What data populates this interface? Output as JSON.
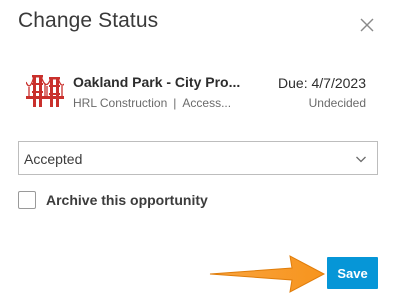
{
  "dialog": {
    "title": "Change Status",
    "close_icon": "close-icon"
  },
  "opportunity": {
    "icon": "golden-gate-bridge-icon",
    "name": "Oakland Park - City Pro...",
    "company": "HRL Construction",
    "separator": "|",
    "detail": "Access...",
    "due": "Due: 4/7/2023",
    "status": "Undecided"
  },
  "status_select": {
    "value": "Accepted",
    "chevron_icon": "chevron-down-icon"
  },
  "archive": {
    "label": "Archive this opportunity",
    "checked": false
  },
  "footer": {
    "save_label": "Save",
    "annotation_icon": "orange-arrow-icon"
  },
  "colors": {
    "accent": "#0696d7",
    "arrow": "#f7941d",
    "bridge": "#c9302c"
  }
}
